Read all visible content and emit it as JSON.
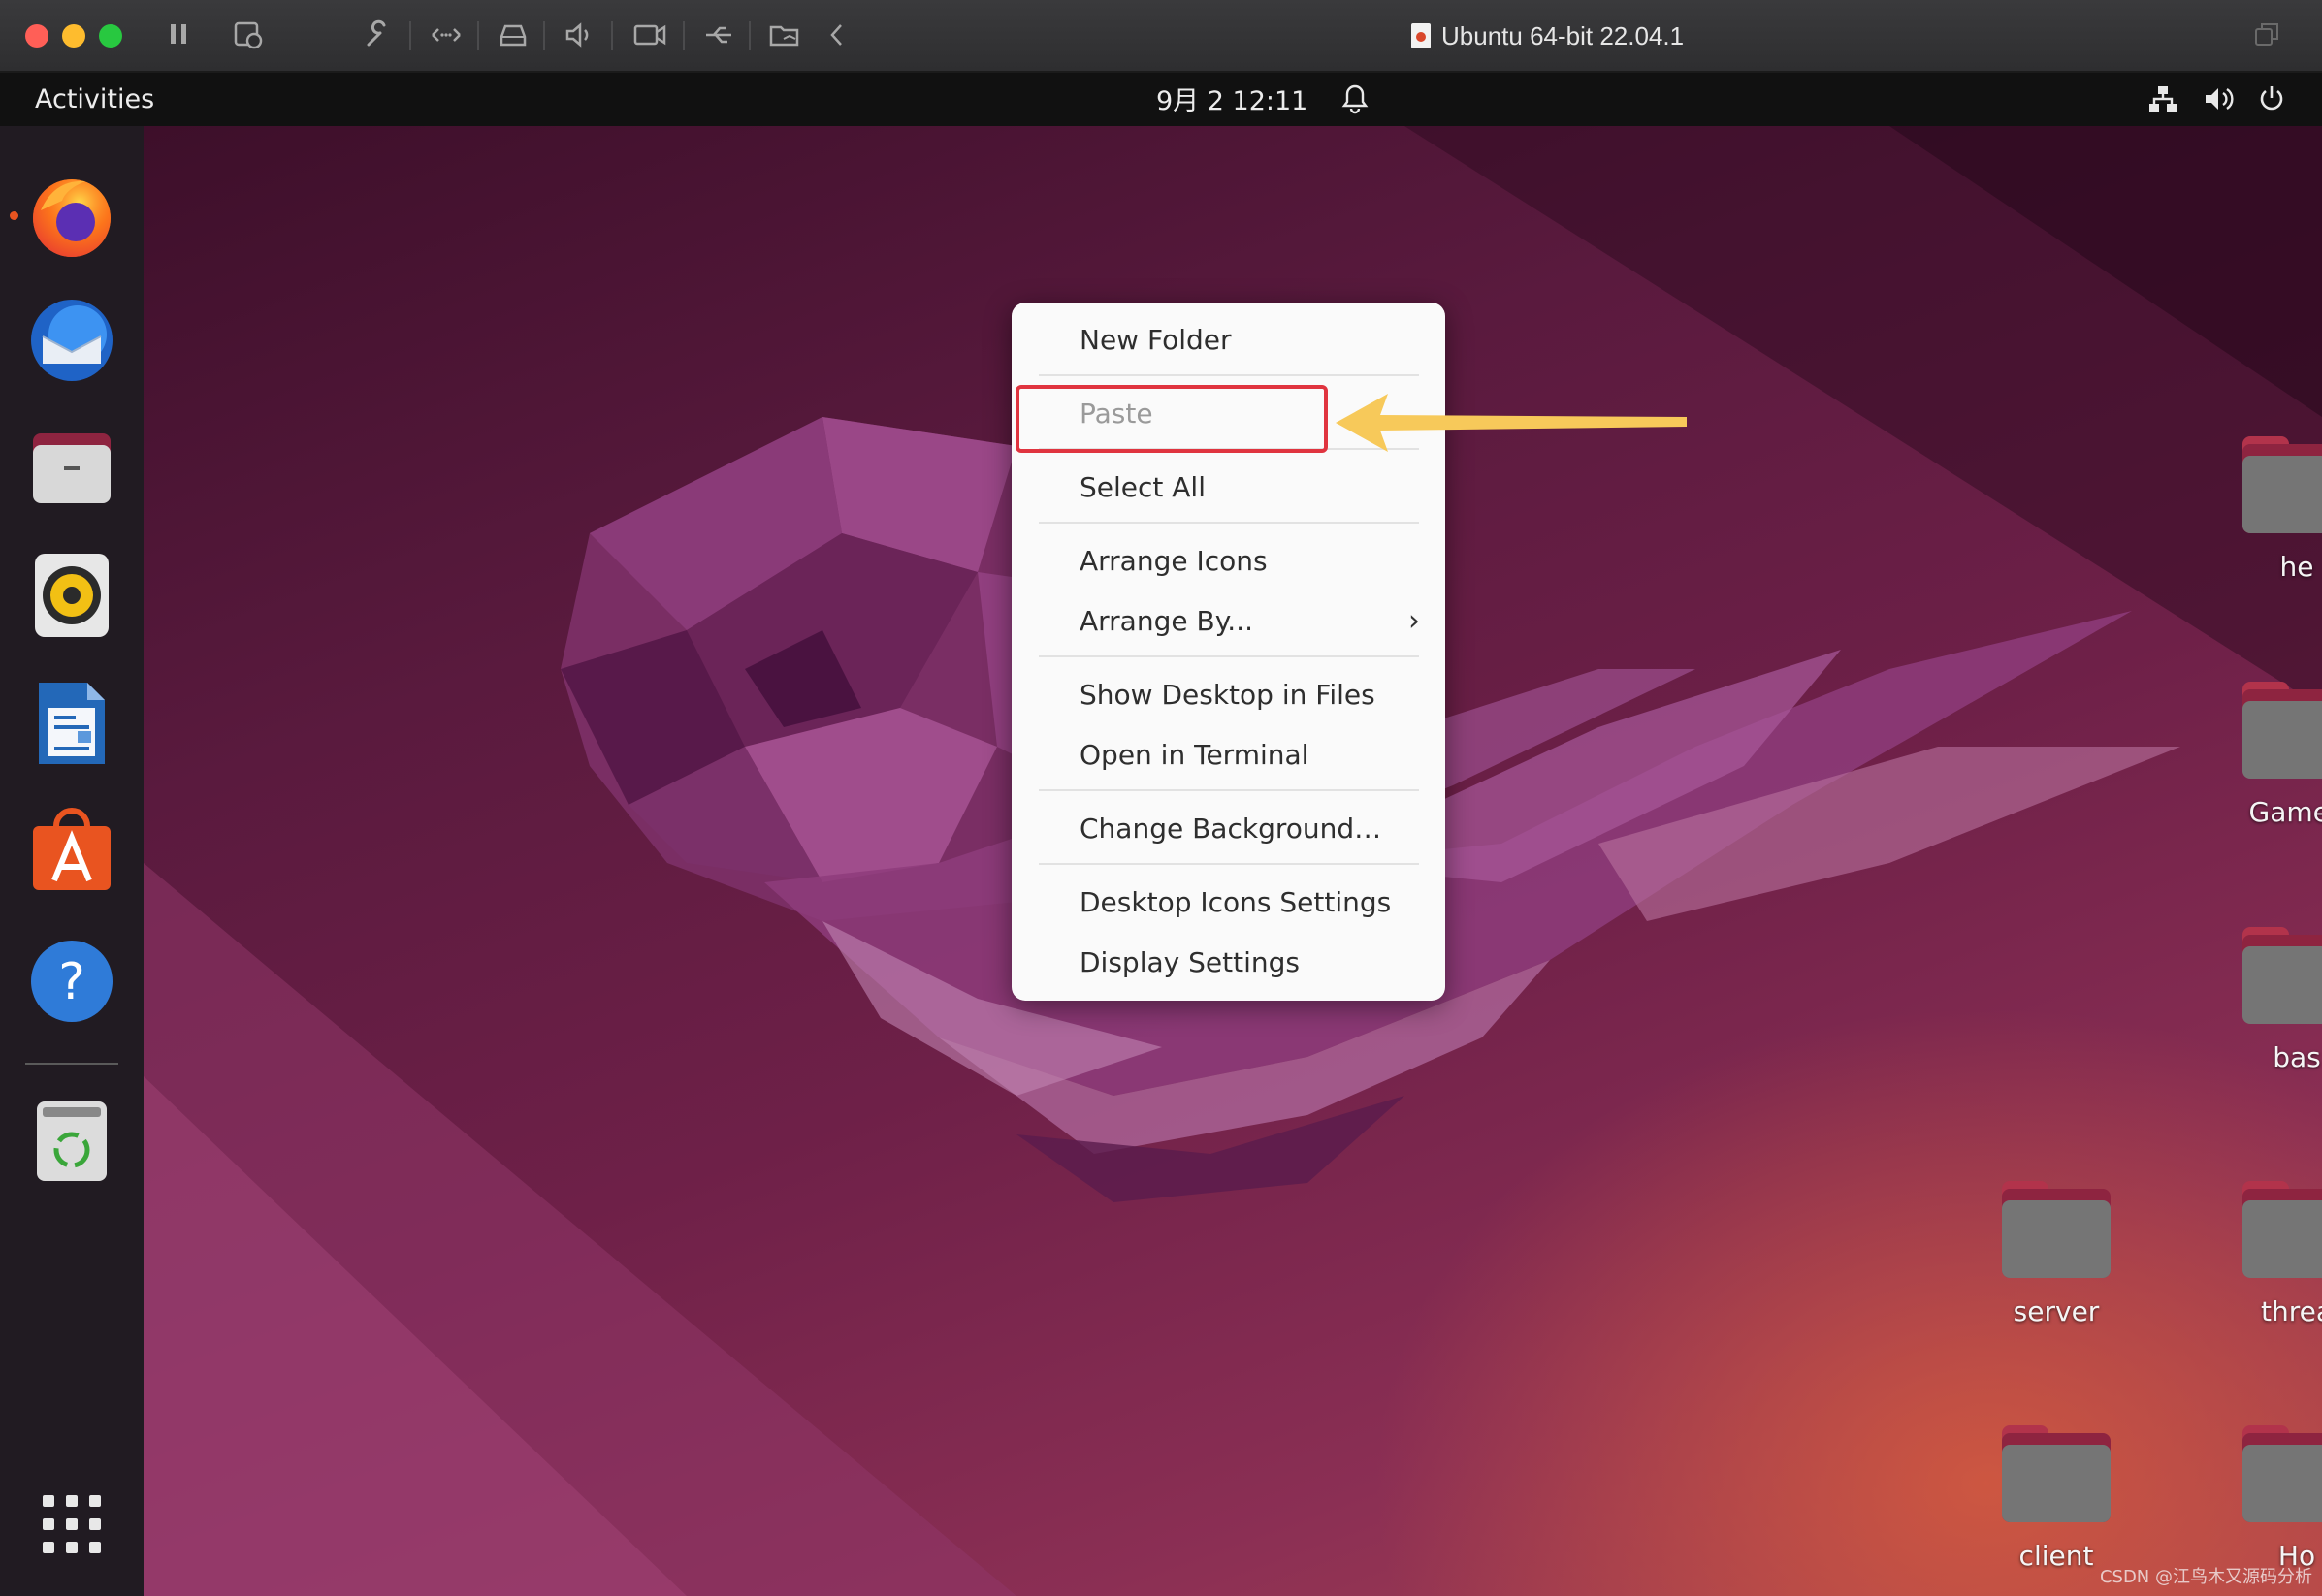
{
  "host_window": {
    "title": "Ubuntu 64-bit 22.04.1",
    "traffic_colors": [
      "#ff5f57",
      "#febc2e",
      "#28c840"
    ]
  },
  "topbar": {
    "activities": "Activities",
    "clock": "9月 2  12:11"
  },
  "dock": {
    "apps": [
      "Firefox",
      "Thunderbird",
      "Files",
      "Rhythmbox",
      "LibreOffice Writer",
      "Ubuntu Software",
      "Help",
      "Trash",
      "Show Applications"
    ]
  },
  "context_menu": {
    "items": [
      {
        "label": "New Folder",
        "enabled": true
      },
      {
        "label": "Paste",
        "enabled": false
      },
      {
        "label": "Select All",
        "enabled": true
      },
      {
        "label": "Arrange Icons",
        "enabled": true
      },
      {
        "label": "Arrange By...",
        "enabled": true,
        "submenu": true
      },
      {
        "label": "Show Desktop in Files",
        "enabled": true
      },
      {
        "label": "Open in Terminal",
        "enabled": true
      },
      {
        "label": "Change Background…",
        "enabled": true
      },
      {
        "label": "Desktop Icons Settings",
        "enabled": true
      },
      {
        "label": "Display Settings",
        "enabled": true
      }
    ],
    "submenu_arrow": "›"
  },
  "desktop_icons": [
    {
      "label": "he"
    },
    {
      "label": "GameL"
    },
    {
      "label": "bas"
    },
    {
      "label": "server"
    },
    {
      "label": "threa"
    },
    {
      "label": "client"
    },
    {
      "label": "Ho"
    }
  ],
  "watermark": "CSDN @江鸟木又源码分析",
  "colors": {
    "accent_orange": "#e95420",
    "highlight_red": "#e0343f",
    "annotation_arrow": "#f7c95a"
  }
}
